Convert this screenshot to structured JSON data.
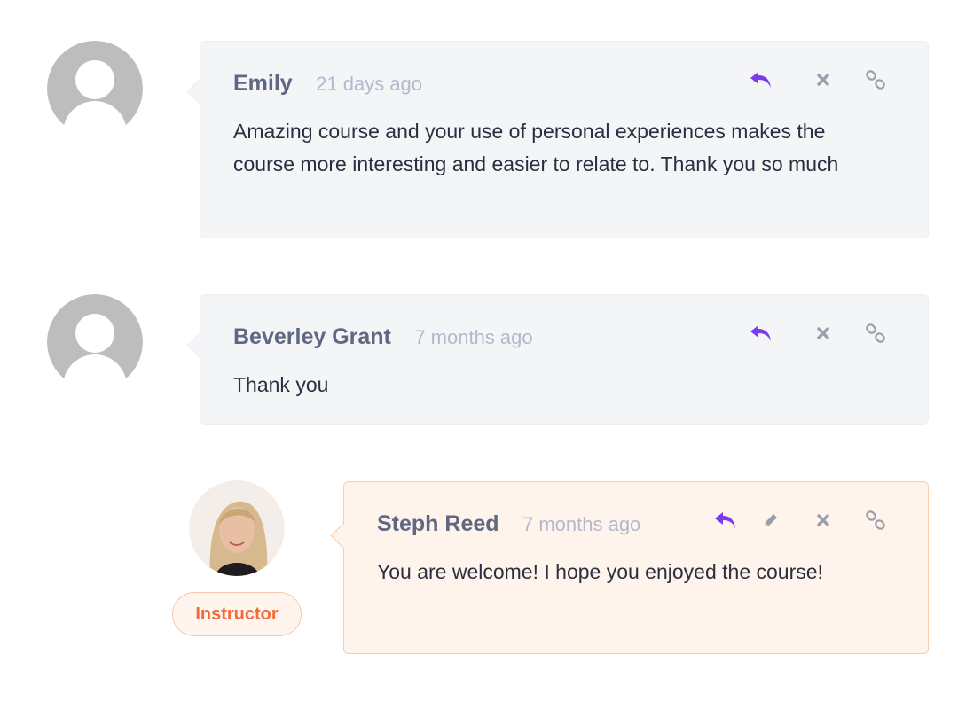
{
  "comments": [
    {
      "author": "Emily",
      "time": "21 days ago",
      "text": "Amazing course and your use of personal experiences makes the course more interesting and easier to relate to. Thank you so much",
      "avatar": "default-avatar"
    },
    {
      "author": "Beverley Grant",
      "time": "7 months ago",
      "text": "Thank you",
      "avatar": "default-avatar"
    },
    {
      "author": "Steph Reed",
      "time": "7 months ago",
      "text": "You are welcome! I hope you enjoyed the course!",
      "avatar": "photo-avatar",
      "badge": "Instructor"
    }
  ],
  "icons": {
    "reply": "reply-icon",
    "edit": "pencil-icon",
    "delete": "close-icon",
    "link": "link-icon"
  },
  "colors": {
    "reply_accent": "#7c3aed",
    "icon_gray": "#9aa0ab",
    "instructor_accent": "#f26b3a",
    "instructor_bg": "#fff4ec",
    "bubble_bg": "#f4f5f7"
  }
}
